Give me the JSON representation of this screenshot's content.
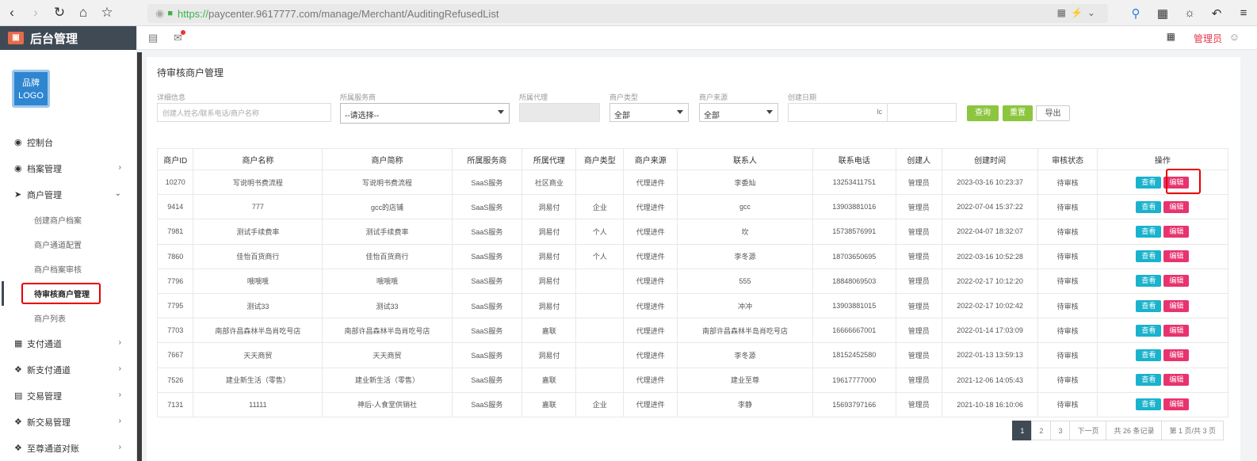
{
  "browser": {
    "url_scheme": "https://",
    "url_rest": "paycenter.9617777.com/manage/Merchant/AuditingRefusedList"
  },
  "sidebar": {
    "title": "后台管理",
    "logo_line1": "品牌",
    "logo_line2": "LOGO",
    "items": [
      {
        "label": "控制台"
      },
      {
        "label": "档案管理"
      },
      {
        "label": "商户管理"
      },
      {
        "label": "支付通道"
      },
      {
        "label": "新支付通道"
      },
      {
        "label": "交易管理"
      },
      {
        "label": "新交易管理"
      },
      {
        "label": "至尊通道对账"
      }
    ],
    "sub_items": [
      {
        "label": "创建商户档案"
      },
      {
        "label": "商户通道配置"
      },
      {
        "label": "商户档案审核"
      },
      {
        "label": "待审核商户管理"
      },
      {
        "label": "商户列表"
      }
    ]
  },
  "appbar": {
    "admin_label": "管理员"
  },
  "page": {
    "title": "待审核商户管理"
  },
  "filters": {
    "detail_label": "详细信息",
    "detail_placeholder": "创建人姓名/联系电话/商户名称",
    "service_label": "所属服务商",
    "service_value": "--请选择--",
    "agent_label": "所属代理",
    "type_label": "商户类型",
    "type_value": "全部",
    "source_label": "商户来源",
    "source_value": "全部",
    "date_label": "创建日期",
    "date_sep": "lc",
    "query_btn": "查询",
    "reset_btn": "重置",
    "export_btn": "导出"
  },
  "table": {
    "headers": [
      "商户ID",
      "商户名称",
      "商户简称",
      "所属服务商",
      "所属代理",
      "商户类型",
      "商户来源",
      "联系人",
      "联系电话",
      "创建人",
      "创建时间",
      "审核状态",
      "操作"
    ],
    "view_label": "查看",
    "edit_label": "编辑",
    "rows": [
      [
        "10270",
        "写说明书费流程",
        "写说明书费流程",
        "SaaS服务",
        "社区商业",
        "",
        "代理进件",
        "李委灿",
        "13253411751",
        "管理员",
        "2023-03-16 10:23:37",
        "待审核"
      ],
      [
        "9414",
        "777",
        "gcc的店铺",
        "SaaS服务",
        "洞易付",
        "企业",
        "代理进件",
        "gcc",
        "13903881016",
        "管理员",
        "2022-07-04 15:37:22",
        "待审核"
      ],
      [
        "7981",
        "测试手续费率",
        "测试手续费率",
        "SaaS服务",
        "洞易付",
        "个人",
        "代理进件",
        "坎",
        "15738576991",
        "管理员",
        "2022-04-07 18:32:07",
        "待审核"
      ],
      [
        "7860",
        "佳怡百货商行",
        "佳怡百货商行",
        "SaaS服务",
        "洞易付",
        "个人",
        "代理进件",
        "李冬源",
        "18703650695",
        "管理员",
        "2022-03-16 10:52:28",
        "待审核"
      ],
      [
        "7796",
        "哦哦哦",
        "哦哦哦",
        "SaaS服务",
        "洞易付",
        "",
        "代理进件",
        "555",
        "18848069503",
        "管理员",
        "2022-02-17 10:12:20",
        "待审核"
      ],
      [
        "7795",
        "测试33",
        "测试33",
        "SaaS服务",
        "洞易付",
        "",
        "代理进件",
        "冲冲",
        "13903881015",
        "管理员",
        "2022-02-17 10:02:42",
        "待审核"
      ],
      [
        "7703",
        "南部许昌森林半岛肖吃号店",
        "南部许昌森林半岛肖吃号店",
        "SaaS服务",
        "嘉联",
        "",
        "代理进件",
        "南部许昌森林半岛肖吃号店",
        "16666667001",
        "管理员",
        "2022-01-14 17:03:09",
        "待审核"
      ],
      [
        "7667",
        "天天商贸",
        "天天商贸",
        "SaaS服务",
        "洞易付",
        "",
        "代理进件",
        "李冬源",
        "18152452580",
        "管理员",
        "2022-01-13 13:59:13",
        "待审核"
      ],
      [
        "7526",
        "建业新生活（零售）",
        "建业新生活（零售）",
        "SaaS服务",
        "嘉联",
        "",
        "代理进件",
        "建业至尊",
        "19617777000",
        "管理员",
        "2021-12-06 14:05:43",
        "待审核"
      ],
      [
        "7131",
        "11111",
        "神后-人食堂供销社",
        "SaaS服务",
        "嘉联",
        "企业",
        "代理进件",
        "李静",
        "15693797166",
        "管理员",
        "2021-10-18 16:10:06",
        "待审核"
      ]
    ]
  },
  "pager": {
    "pages": [
      "1",
      "2",
      "3"
    ],
    "next": "下一页",
    "total": "共 26 条记录",
    "page_of": "第 1 页/共 3 页"
  }
}
